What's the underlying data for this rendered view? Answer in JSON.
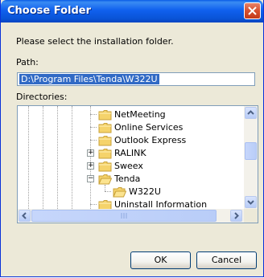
{
  "window": {
    "title": "Choose Folder"
  },
  "content": {
    "instruction": "Please select the installation folder.",
    "path_label": "Path:",
    "path_value": "D:\\Program Files\\Tenda\\W322U",
    "directories_label": "Directories:"
  },
  "tree": {
    "items": [
      {
        "label": "NetMeeting",
        "expander": ""
      },
      {
        "label": "Online Services",
        "expander": ""
      },
      {
        "label": "Outlook Express",
        "expander": ""
      },
      {
        "label": "RALINK",
        "expander": "+"
      },
      {
        "label": "Sweex",
        "expander": "+"
      },
      {
        "label": "Tenda",
        "expander": "−"
      },
      {
        "label": "W322U",
        "expander": ""
      },
      {
        "label": "Uninstall Information",
        "expander": ""
      }
    ]
  },
  "buttons": {
    "ok": "OK",
    "cancel": "Cancel"
  },
  "colors": {
    "title_bar": "#0a55d8",
    "selection": "#316ac5",
    "folder": "#f5d36b"
  }
}
